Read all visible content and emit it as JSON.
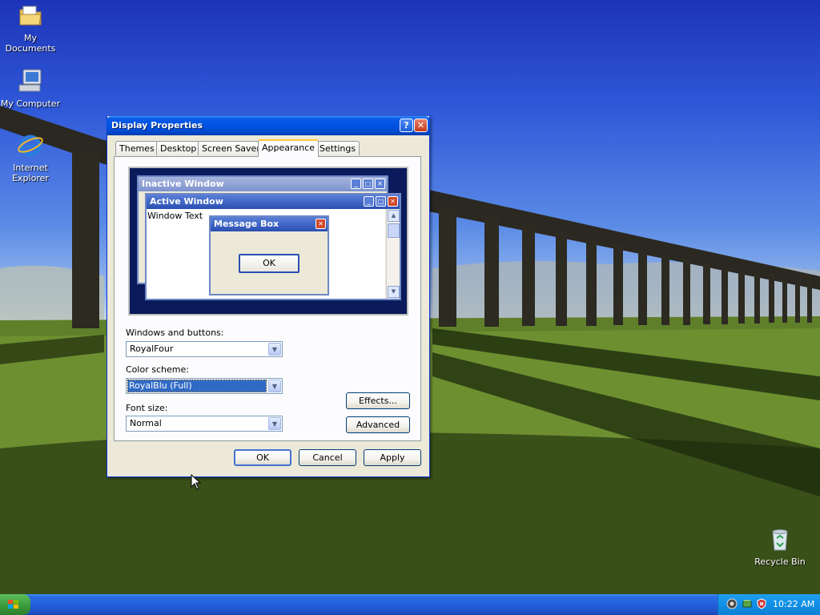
{
  "desktop": {
    "icons": [
      {
        "label": "My Documents",
        "icon": "folder-icon"
      },
      {
        "label": "My Computer",
        "icon": "computer-icon"
      },
      {
        "label": "Internet Explorer",
        "icon": "internet-explorer-icon"
      },
      {
        "label": "Recycle Bin",
        "icon": "recycle-bin-icon"
      }
    ]
  },
  "dialog": {
    "title": "Display Properties",
    "help_label": "?",
    "close_label": "✕",
    "tabs": [
      "Themes",
      "Desktop",
      "Screen Saver",
      "Appearance",
      "Settings"
    ],
    "active_tab": "Appearance",
    "preview": {
      "inactive_title": "Inactive Window",
      "active_title": "Active Window",
      "window_text": "Window Text",
      "message_box_title": "Message Box",
      "message_box_ok": "OK"
    },
    "windows_buttons_label": "Windows and buttons:",
    "windows_buttons_value": "RoyalFour",
    "color_scheme_label": "Color scheme:",
    "color_scheme_value": "RoyalBlu (Full)",
    "font_size_label": "Font size:",
    "font_size_value": "Normal",
    "effects_label": "Effects...",
    "advanced_label": "Advanced",
    "ok_label": "OK",
    "cancel_label": "Cancel",
    "apply_label": "Apply"
  },
  "taskbar": {
    "clock": "10:22 AM"
  },
  "colors": {
    "title_bar": "#0054e3",
    "dialog_bg": "#ece9d8",
    "selection": "#316ac5",
    "taskbar": "#245edb",
    "start_button": "#3c9e3c"
  }
}
